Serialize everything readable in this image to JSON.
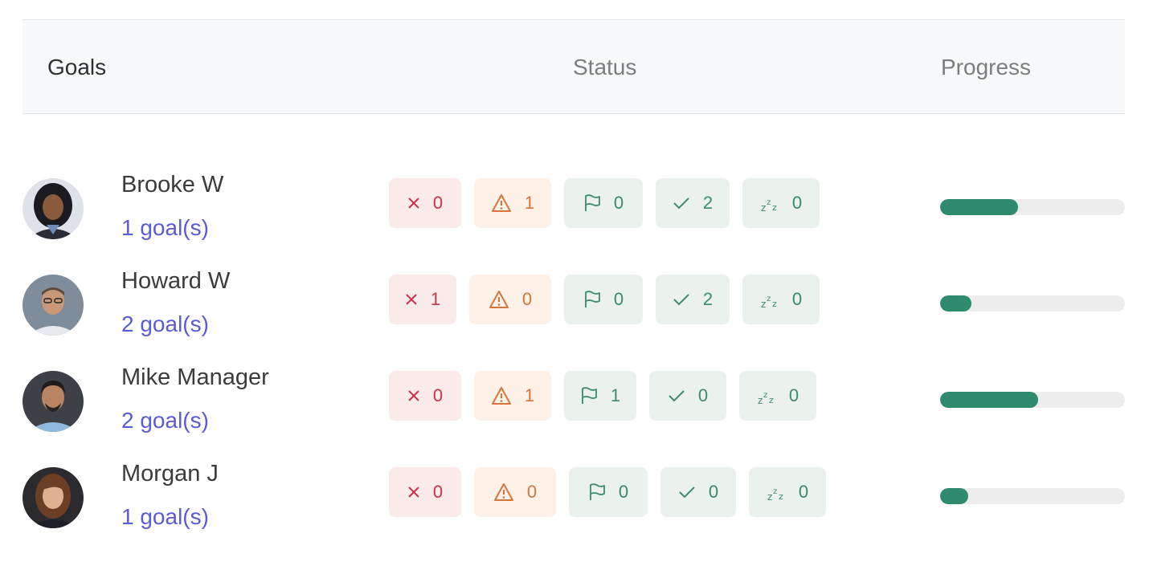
{
  "header": {
    "goals": "Goals",
    "status": "Status",
    "progress": "Progress"
  },
  "colors": {
    "link": "#5b5bd6",
    "progress_fill": "#2e8b6e",
    "status_red": "#c8324a",
    "status_orange": "#d7763a",
    "status_green": "#3c8b6d"
  },
  "status_icons": [
    "close-icon",
    "warning-icon",
    "flag-icon",
    "check-icon",
    "sleep-icon"
  ],
  "rows": [
    {
      "name": "Brooke W",
      "goals": "1 goal(s)",
      "status": {
        "off_track": "0",
        "at_risk": "1",
        "flagged": "0",
        "on_track": "2",
        "paused": "0"
      },
      "progress": 0.42
    },
    {
      "name": "Howard W",
      "goals": "2 goal(s)",
      "status": {
        "off_track": "1",
        "at_risk": "0",
        "flagged": "0",
        "on_track": "2",
        "paused": "0"
      },
      "progress": 0.17
    },
    {
      "name": "Mike Manager",
      "goals": "2 goal(s)",
      "status": {
        "off_track": "0",
        "at_risk": "1",
        "flagged": "1",
        "on_track": "0",
        "paused": "0"
      },
      "progress": 0.53
    },
    {
      "name": "Morgan J",
      "goals": "1 goal(s)",
      "status": {
        "off_track": "0",
        "at_risk": "0",
        "flagged": "0",
        "on_track": "0",
        "paused": "0"
      },
      "progress": 0.15
    }
  ]
}
